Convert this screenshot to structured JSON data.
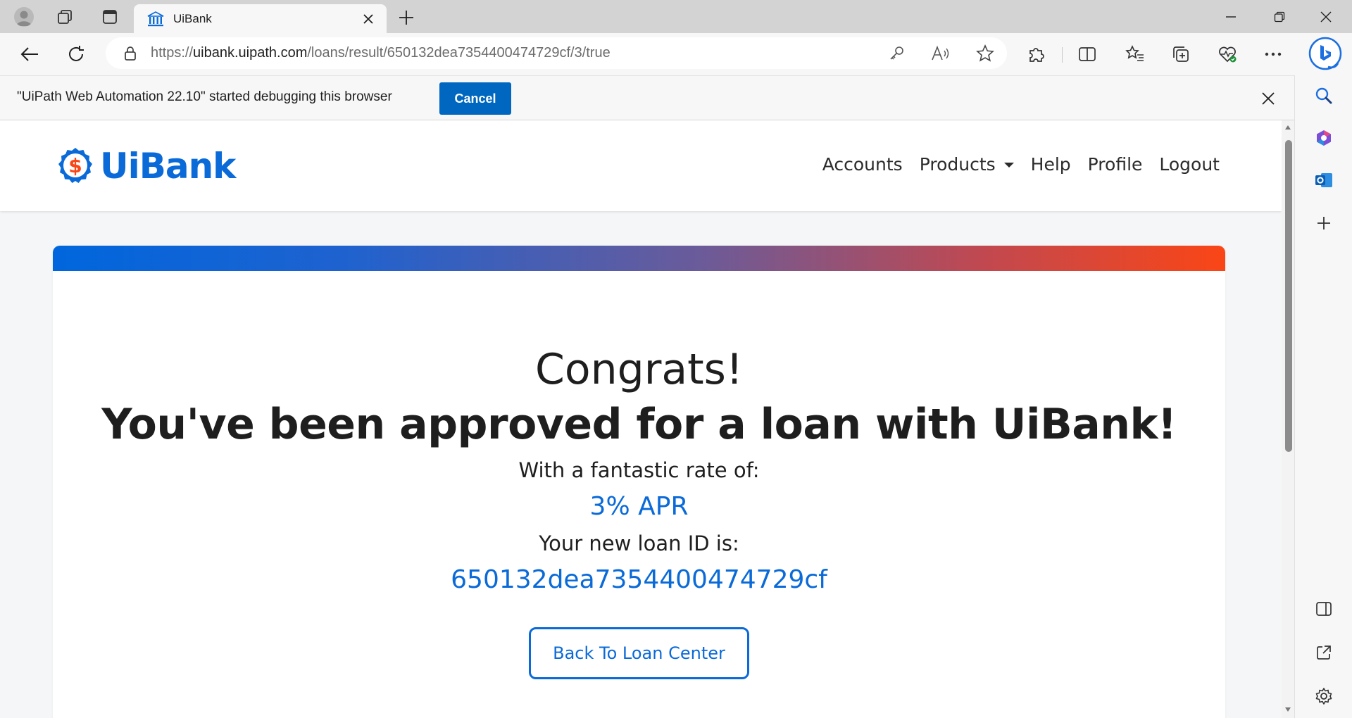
{
  "browser": {
    "tab_title": "UiBank",
    "url_prefix": "https://",
    "url_host": "uibank.uipath.com",
    "url_path": "/loans/result/650132dea7354400474729cf/3/true"
  },
  "infobar": {
    "message": "\"UiPath Web Automation 22.10\" started debugging this browser",
    "cancel_label": "Cancel"
  },
  "site": {
    "logo_text": "UiBank",
    "nav": {
      "accounts": "Accounts",
      "products": "Products",
      "help": "Help",
      "profile": "Profile",
      "logout": "Logout"
    }
  },
  "result": {
    "congrats": "Congrats!",
    "approved": "You've been approved for a loan with UiBank!",
    "rate_label": "With a fantastic rate of:",
    "rate_value": "3% APR",
    "loan_id_label": "Your new loan ID is:",
    "loan_id_value": "650132dea7354400474729cf",
    "back_button": "Back To Loan Center"
  },
  "colors": {
    "brand_blue": "#0a6ad8",
    "brand_orange": "#fa4616",
    "infobar_button": "#0067c0"
  }
}
